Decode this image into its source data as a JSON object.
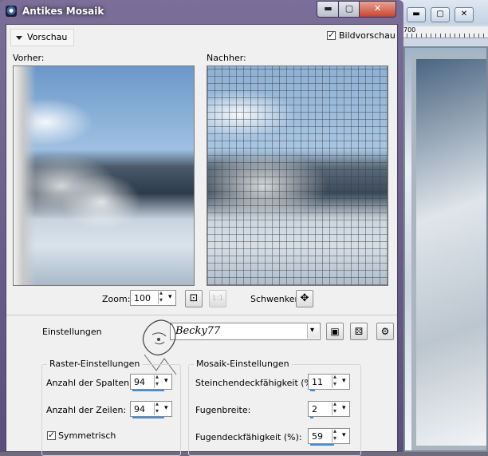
{
  "dialog": {
    "title": "Antikes Mosaik",
    "caption_buttons": {
      "minimize": "▬",
      "maximize": "▢",
      "close": "✕"
    }
  },
  "preview": {
    "toggle_label": "Vorschau",
    "bildvorschau_label": "Bildvorschau",
    "bildvorschau_checked": true,
    "before_label": "Vorher:",
    "after_label": "Nachher:"
  },
  "zoom": {
    "label": "Zoom:",
    "value": "100",
    "fit_icon": "fit-to-window-icon",
    "actual_size_icon": "actual-size-icon",
    "actual_size_text": "1:1",
    "pan_label": "Schwenken:",
    "pan_icon": "move-arrows-icon"
  },
  "settings": {
    "label": "Einstellungen",
    "preset_value": "Becky77",
    "save_icon": "save-floppy-icon",
    "reset_icon": "reset-dice-icon",
    "manage_icon": "manage-presets-icon"
  },
  "raster": {
    "title": "Raster-Einstellungen",
    "columns_label": "Anzahl der Spalten:",
    "columns_value": "94",
    "rows_label": "Anzahl der Zeilen:",
    "rows_value": "94",
    "symmetric_label": "Symmetrisch",
    "symmetric_checked": true
  },
  "mosaic": {
    "title": "Mosaik-Einstellungen",
    "tile_opacity_label": "Steinchendeckfähigkeit (%):",
    "tile_opacity_value": "11",
    "grout_width_label": "Fugenbreite:",
    "grout_width_value": "2",
    "grout_opacity_label": "Fugendeckfähigkeit (%):",
    "grout_opacity_value": "59"
  },
  "background_window": {
    "ruler_text": "700"
  },
  "colors": {
    "titlebar": "#6b5f8c",
    "client_bg": "#f0f0f0",
    "accent_bar": "#3a8ee6",
    "close_button": "#c8452f"
  }
}
